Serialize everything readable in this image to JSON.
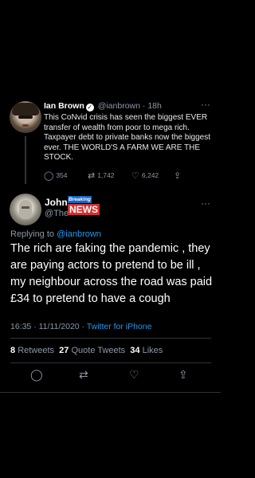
{
  "parent_tweet": {
    "name": "Ian Brown",
    "handle": "@ianbrown",
    "time": "18h",
    "text": "This CoNvid crisis has seen the biggest EVER transfer of wealth from poor to mega rich. Taxpayer debt to private banks now the biggest ever. THE WORLD'S A FARM WE ARE THE STOCK.",
    "replies": "354",
    "retweets": "1,742",
    "likes": "6,242"
  },
  "main_tweet": {
    "name": "John",
    "handle": "@The",
    "badge_top": "Breaking",
    "badge_bottom": "NEWS",
    "replying_prefix": "Replying to",
    "replying_to": "@ianbrown",
    "text": "The rich are faking the pandemic , they are paying actors to pretend to be ill , my neighbour across the road was paid £34 to pretend to have a cough",
    "time": "16:35",
    "date": "11/11/2020",
    "client": "Twitter for iPhone",
    "retweets_count": "8",
    "retweets_label": "Retweets",
    "quote_count": "27",
    "quote_label": "Quote Tweets",
    "likes_count": "34",
    "likes_label": "Likes"
  },
  "icons": {
    "reply": "reply-icon",
    "retweet": "retweet-icon",
    "like": "heart-icon",
    "share": "share-icon",
    "more": "more-icon",
    "verified": "verified-badge-icon"
  },
  "colors": {
    "background": "#000000",
    "link": "#1d9bf0",
    "muted": "#8b98a5"
  }
}
